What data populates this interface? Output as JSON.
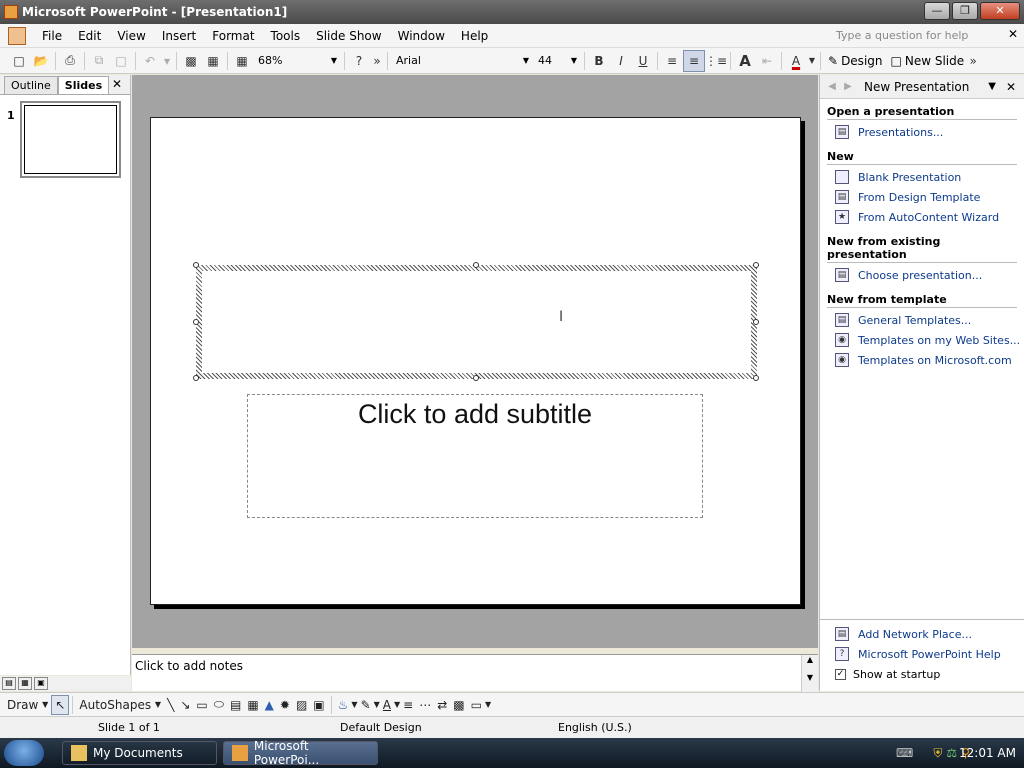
{
  "window": {
    "title": "Microsoft PowerPoint - [Presentation1]"
  },
  "menu": {
    "items": [
      "File",
      "Edit",
      "View",
      "Insert",
      "Format",
      "Tools",
      "Slide Show",
      "Window",
      "Help"
    ],
    "help_placeholder": "Type a question for help"
  },
  "toolbar": {
    "zoom": "68%",
    "font": "Arial",
    "font_size": "44",
    "bold": "B",
    "italic": "I",
    "underline": "U",
    "design_label": "Design",
    "new_slide_label": "New Slide"
  },
  "left_pane": {
    "tabs": [
      "Outline",
      "Slides"
    ],
    "active_tab": "Slides",
    "slide_number": "1"
  },
  "slide": {
    "subtitle_placeholder": "Click to add subtitle"
  },
  "notes": {
    "placeholder": "Click to add notes"
  },
  "task_pane": {
    "title": "New Presentation",
    "sections": [
      {
        "heading": "Open a presentation",
        "links": [
          "Presentations..."
        ]
      },
      {
        "heading": "New",
        "links": [
          "Blank Presentation",
          "From Design Template",
          "From AutoContent Wizard"
        ]
      },
      {
        "heading": "New from existing presentation",
        "links": [
          "Choose presentation..."
        ]
      },
      {
        "heading": "New from template",
        "links": [
          "General Templates...",
          "Templates on my Web Sites...",
          "Templates on Microsoft.com"
        ]
      }
    ],
    "bottom_links": [
      "Add Network Place...",
      "Microsoft PowerPoint Help"
    ],
    "show_at_startup": "Show at startup"
  },
  "drawbar": {
    "draw_label": "Draw",
    "autoshapes_label": "AutoShapes"
  },
  "status": {
    "slide": "Slide 1 of 1",
    "design": "Default Design",
    "language": "English (U.S.)"
  },
  "taskbar": {
    "tasks": [
      "My Documents",
      "Microsoft PowerPoi..."
    ],
    "clock": "12:01 AM"
  }
}
